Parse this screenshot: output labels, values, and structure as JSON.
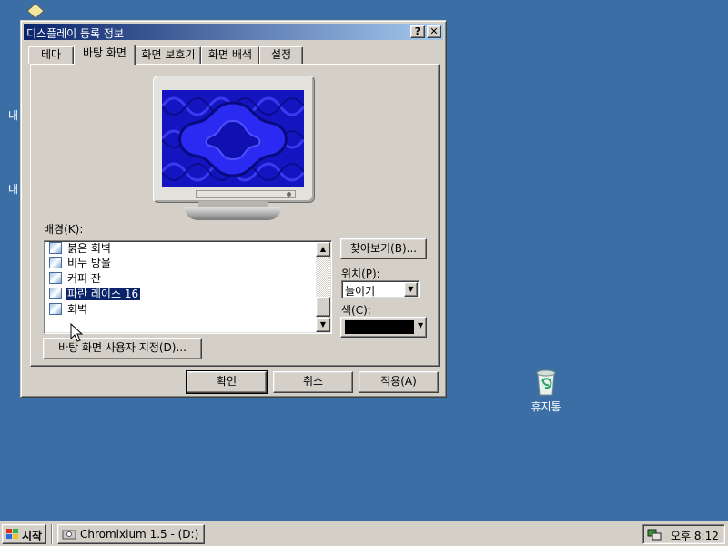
{
  "window": {
    "title": "디스플레이 등록 정보",
    "help_btn": "?",
    "close_btn": "✕"
  },
  "tabs": [
    {
      "label": "테마"
    },
    {
      "label": "바탕 화면"
    },
    {
      "label": "화면 보호기"
    },
    {
      "label": "화면 배색"
    },
    {
      "label": "설정"
    }
  ],
  "background": {
    "label": "배경(K):",
    "items": [
      {
        "label": "붉은 회벽"
      },
      {
        "label": "비누 방울"
      },
      {
        "label": "커피 잔"
      },
      {
        "label": "파란 레이스 16",
        "selected": true
      },
      {
        "label": "회벽"
      }
    ]
  },
  "buttons": {
    "browse": "찾아보기(B)...",
    "customize": "바탕 화면 사용자 지정(D)...",
    "ok": "확인",
    "cancel": "취소",
    "apply": "적용(A)"
  },
  "position": {
    "label": "위치(P):",
    "value": "늘이기"
  },
  "color": {
    "label": "색(C):",
    "value_hex": "#000000"
  },
  "desktop": {
    "recycle_bin": "휴지통",
    "partial_labels": [
      "내",
      "내"
    ]
  },
  "taskbar": {
    "start": "시작",
    "task": "Chromixium 1.5 - (D:)",
    "clock": "오후 8:12"
  }
}
